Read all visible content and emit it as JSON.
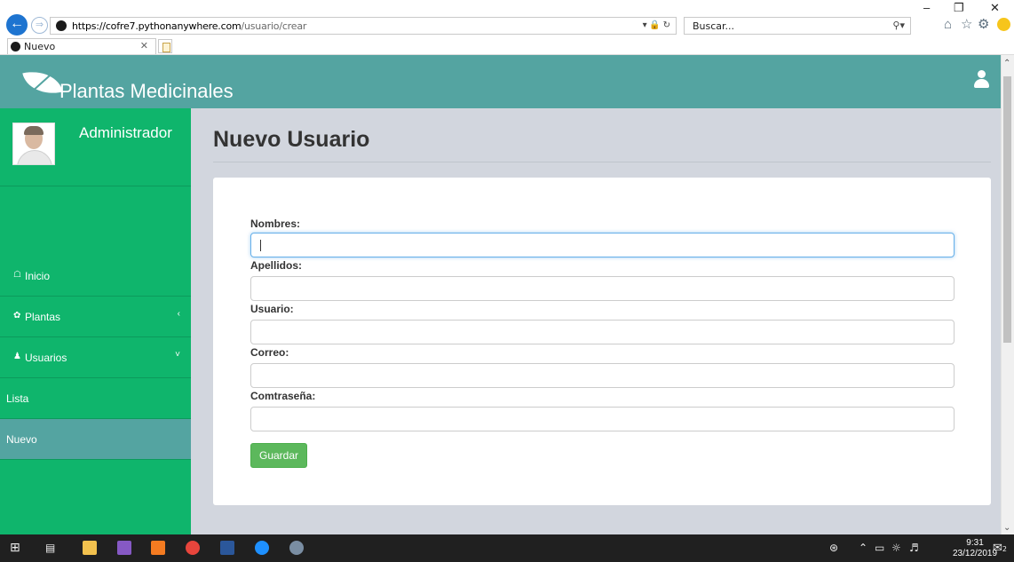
{
  "browser": {
    "url_scheme_host": "https://cofre7.pythonanywhere.com",
    "url_path": "/usuario/crear",
    "search_placeholder": "Buscar...",
    "tab_title": "Nuevo",
    "win_minimize": "–",
    "win_restore": "❐",
    "win_close": "✕"
  },
  "app": {
    "brand": "Plantas Medicinales",
    "user_name": "Administrador",
    "colors": {
      "topbar": "#54a4a1",
      "sidebar": "#0fb56c",
      "active": "#54a4a1",
      "button": "#5cb85c"
    }
  },
  "sidebar": {
    "items": [
      {
        "label": "Inicio",
        "icon": "home-icon"
      },
      {
        "label": "Plantas",
        "icon": "leaf-icon",
        "chevron": "‹"
      },
      {
        "label": "Usuarios",
        "icon": "user-icon",
        "chevron": "˅"
      },
      {
        "label": "Lista"
      },
      {
        "label": "Nuevo",
        "active": true
      }
    ]
  },
  "main": {
    "title": "Nuevo Usuario",
    "form": {
      "fields": [
        {
          "label": "Nombres:",
          "value": ""
        },
        {
          "label": "Apellidos:",
          "value": ""
        },
        {
          "label": "Usuario:",
          "value": ""
        },
        {
          "label": "Correo:",
          "value": ""
        },
        {
          "label": "Comtraseña:",
          "value": ""
        }
      ],
      "submit_label": "Guardar"
    }
  },
  "taskbar": {
    "time": "9:31",
    "date": "23/12/2019",
    "notifications": "2"
  }
}
